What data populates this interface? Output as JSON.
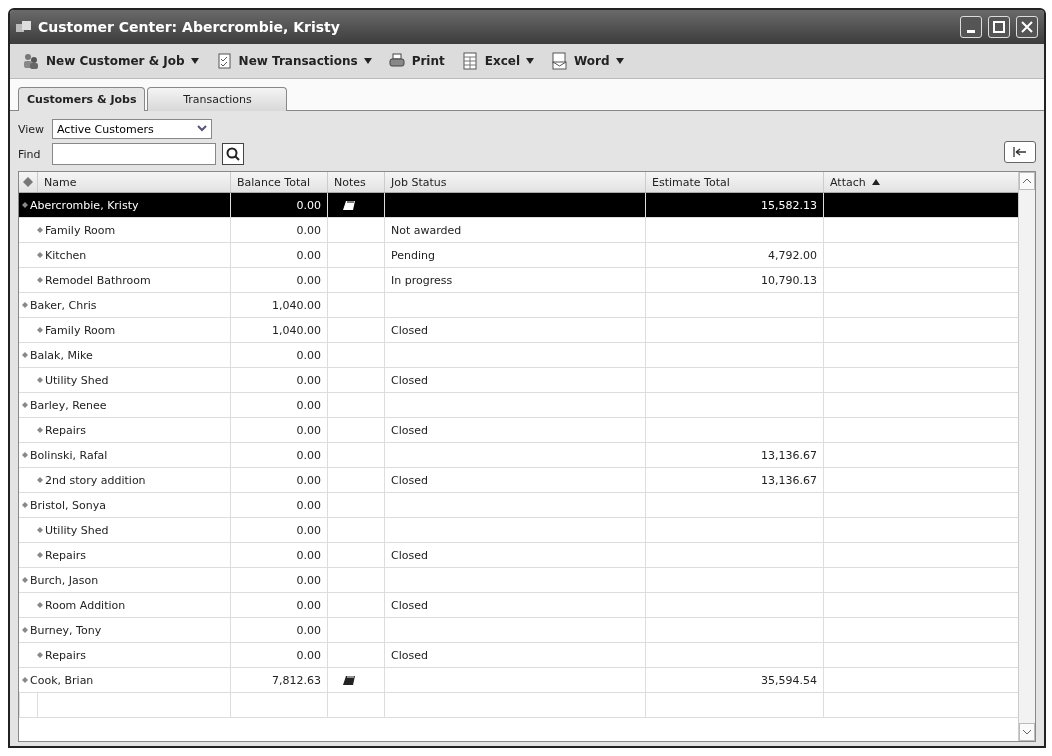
{
  "window": {
    "title": "Customer Center: Abercrombie, Kristy"
  },
  "toolbar": [
    {
      "label": "New Customer & Job",
      "kind": "customer",
      "dropdown": true
    },
    {
      "label": "New Transactions",
      "kind": "transactions",
      "dropdown": true
    },
    {
      "label": "Print",
      "kind": "print",
      "dropdown": false
    },
    {
      "label": "Excel",
      "kind": "excel",
      "dropdown": true
    },
    {
      "label": "Word",
      "kind": "word",
      "dropdown": true
    }
  ],
  "tabs": [
    {
      "label": "Customers & Jobs",
      "selected": true
    },
    {
      "label": "Transactions",
      "selected": false
    }
  ],
  "view": {
    "label": "View",
    "value": "Active Customers"
  },
  "find": {
    "label": "Find"
  },
  "table": {
    "columns": [
      "Name",
      "Balance Total",
      "Notes",
      "Job Status",
      "Estimate Total",
      "Attach"
    ],
    "rows": [
      {
        "name": "Abercrombie, Kristy",
        "balance": "0.00",
        "notes": true,
        "estimate": "15,582.13",
        "selected": true,
        "children": [
          {
            "name": "Family Room",
            "balance": "0.00",
            "notes": false,
            "status": "Not awarded",
            "selected": false
          },
          {
            "name": "Kitchen",
            "balance": "0.00",
            "notes": false,
            "status": "Pending",
            "estimate": "4,792.00",
            "selected": false
          },
          {
            "name": "Remodel Bathroom",
            "balance": "0.00",
            "notes": false,
            "status": "In progress",
            "estimate": "10,790.13",
            "selected": false
          }
        ]
      },
      {
        "name": "Baker, Chris",
        "balance": "1,040.00",
        "notes": false,
        "selected": false,
        "children": [
          {
            "name": "Family Room",
            "balance": "1,040.00",
            "notes": false,
            "status": "Closed",
            "selected": false
          }
        ]
      },
      {
        "name": "Balak, Mike",
        "balance": "0.00",
        "notes": false,
        "selected": false,
        "children": [
          {
            "name": "Utility Shed",
            "balance": "0.00",
            "notes": false,
            "status": "Closed",
            "selected": false
          }
        ]
      },
      {
        "name": "Barley, Renee",
        "balance": "0.00",
        "notes": false,
        "selected": false,
        "children": [
          {
            "name": "Repairs",
            "balance": "0.00",
            "notes": false,
            "status": "Closed",
            "selected": false
          }
        ]
      },
      {
        "name": "Bolinski, Rafal",
        "balance": "0.00",
        "notes": false,
        "estimate": "13,136.67",
        "selected": false,
        "children": [
          {
            "name": "2nd story addition",
            "balance": "0.00",
            "notes": false,
            "status": "Closed",
            "estimate": "13,136.67",
            "selected": false
          }
        ]
      },
      {
        "name": "Bristol, Sonya",
        "balance": "0.00",
        "notes": false,
        "selected": false,
        "children": [
          {
            "name": "Utility Shed",
            "balance": "0.00",
            "notes": false,
            "selected": false
          },
          {
            "name": "Repairs",
            "balance": "0.00",
            "notes": false,
            "status": "Closed",
            "selected": false
          }
        ]
      },
      {
        "name": "Burch, Jason",
        "balance": "0.00",
        "notes": false,
        "selected": false,
        "children": [
          {
            "name": "Room Addition",
            "balance": "0.00",
            "notes": false,
            "status": "Closed",
            "selected": false
          }
        ]
      },
      {
        "name": "Burney, Tony",
        "balance": "0.00",
        "notes": false,
        "selected": false,
        "children": [
          {
            "name": "Repairs",
            "balance": "0.00",
            "notes": false,
            "status": "Closed",
            "selected": false
          }
        ]
      },
      {
        "name": "Cook, Brian",
        "balance": "7,812.63",
        "notes": true,
        "estimate": "35,594.54",
        "selected": false
      }
    ]
  }
}
